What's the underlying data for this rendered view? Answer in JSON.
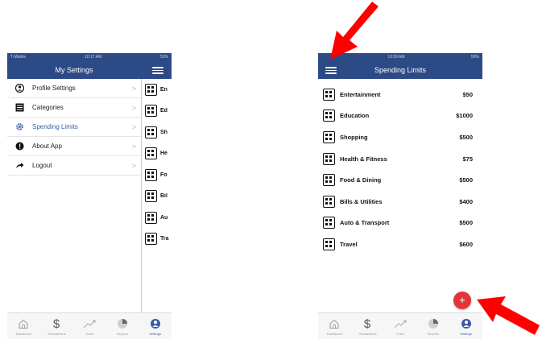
{
  "colors": {
    "navbar": "#2c4a86",
    "accent": "#3b5ca5",
    "fab": "#e3343a",
    "arrow": "#ff0000"
  },
  "left_phone": {
    "status": {
      "carrier": "T-Mobile",
      "time": "10:17 AM",
      "battery": "53%"
    },
    "title": "My Settings",
    "menu": [
      {
        "label": "Profile Settings",
        "icon": "user-circle-icon"
      },
      {
        "label": "Categories",
        "icon": "list-icon"
      },
      {
        "label": "Spending Limits",
        "icon": "gear-icon",
        "active": true
      },
      {
        "label": "About App",
        "icon": "info-icon"
      },
      {
        "label": "Logout",
        "icon": "logout-arrow-icon"
      }
    ],
    "chevron": ">",
    "under_rows": [
      "En",
      "Ed",
      "Sh",
      "He",
      "Fo",
      "Bil",
      "Au",
      "Tra"
    ],
    "tabs": [
      {
        "label": "Dashboard",
        "icon": "home-icon"
      },
      {
        "label": "Transactions",
        "icon": "dollar-icon"
      },
      {
        "label": "Track",
        "icon": "trend-icon"
      },
      {
        "label": "Reports",
        "icon": "pie-icon"
      },
      {
        "label": "Settings",
        "icon": "settings-user-icon",
        "active": true
      }
    ]
  },
  "right_phone": {
    "status": {
      "carrier": "",
      "time": "10:59 AM",
      "battery": "59%"
    },
    "title": "Spending Limits",
    "limits": [
      {
        "name": "Entertainment",
        "amount": "$50"
      },
      {
        "name": "Education",
        "amount": "$1000"
      },
      {
        "name": "Shopping",
        "amount": "$500"
      },
      {
        "name": "Health & Fitness",
        "amount": "$75"
      },
      {
        "name": "Food & Dining",
        "amount": "$500"
      },
      {
        "name": "Bills & Utilities",
        "amount": "$400"
      },
      {
        "name": "Auto & Transport",
        "amount": "$500"
      },
      {
        "name": "Travel",
        "amount": "$600"
      }
    ],
    "fab_label": "+",
    "tabs": [
      {
        "label": "Dashboard",
        "icon": "home-icon"
      },
      {
        "label": "Transactions",
        "icon": "dollar-icon"
      },
      {
        "label": "Track",
        "icon": "trend-icon"
      },
      {
        "label": "Reports",
        "icon": "pie-icon"
      },
      {
        "label": "Settings",
        "icon": "settings-user-icon",
        "active": true
      }
    ]
  }
}
